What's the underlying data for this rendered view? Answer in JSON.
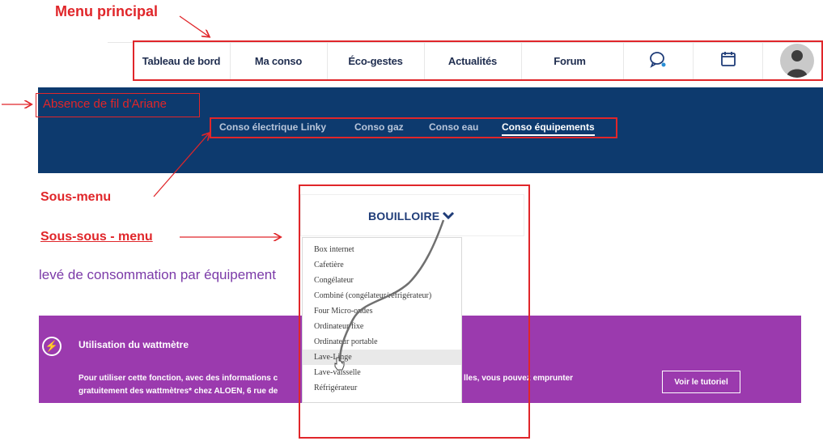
{
  "annotations": {
    "main_menu": "Menu principal",
    "no_breadcrumb": "Absence de fil d'Ariane",
    "submenu": "Sous-menu",
    "subsubmenu": "Sous-sous - menu"
  },
  "top_nav": {
    "items": [
      "Tableau de bord",
      "Ma conso",
      "Éco-gestes",
      "Actualités",
      "Forum"
    ],
    "icons": [
      "chat-icon",
      "calendar-icon",
      "avatar-icon"
    ]
  },
  "sub_nav": {
    "items": [
      "Conso électrique Linky",
      "Conso gaz",
      "Conso eau",
      "Conso équipements"
    ],
    "active": "Conso équipements"
  },
  "lead_text": "levé de consommation par équipement",
  "select": {
    "value": "BOUILLOIRE",
    "options": [
      "Box internet",
      "Cafetière",
      "Congélateur",
      "Combiné (congélateur/réfrigérateur)",
      "Four Micro-ondes",
      "Ordinateur fixe",
      "Ordinateur portable",
      "Lave-Linge",
      "Lave-vaisselle",
      "Réfrigérateur"
    ],
    "hovered": "Lave-Linge"
  },
  "banner": {
    "title": "Utilisation du wattmètre",
    "line1_left": "Pour utiliser cette fonction, avec des informations c",
    "line1_right": "lles, vous pouvez emprunter",
    "line2_left": "gratuitement des wattmètres* chez ALOEN, 6 rue de",
    "button": "Voir le tutoriel"
  },
  "colors": {
    "annotation": "#e0262a",
    "navy": "#0d3a6e",
    "purple": "#9b3aae",
    "text_purple": "#7b3aa8"
  }
}
